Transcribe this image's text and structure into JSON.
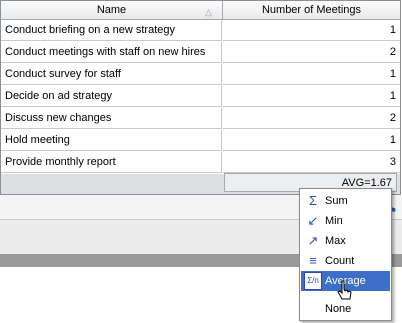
{
  "grid": {
    "columns": [
      "Name",
      "Number of Meetings"
    ],
    "rows": [
      {
        "name": "Conduct briefing on a new strategy",
        "value": "1"
      },
      {
        "name": "Conduct meetings with staff on new hires",
        "value": "2"
      },
      {
        "name": "Conduct survey for staff",
        "value": "1"
      },
      {
        "name": "Decide on ad strategy",
        "value": "1"
      },
      {
        "name": "Discuss new changes",
        "value": "2"
      },
      {
        "name": "Hold meeting",
        "value": "1"
      },
      {
        "name": "Provide monthly report",
        "value": "3"
      }
    ],
    "summary": "AVG=1.67"
  },
  "menu": {
    "items": [
      {
        "label": "Sum",
        "icon": "sigma-icon",
        "glyph": "Σ"
      },
      {
        "label": "Min",
        "icon": "min-icon",
        "glyph": "↙"
      },
      {
        "label": "Max",
        "icon": "max-icon",
        "glyph": "↗"
      },
      {
        "label": "Count",
        "icon": "count-icon",
        "glyph": "≡"
      },
      {
        "label": "Average",
        "icon": "average-icon",
        "glyph": "Σ/n"
      },
      {
        "label": "None",
        "icon": "",
        "glyph": ""
      }
    ],
    "selected": "Average"
  },
  "colors": {
    "selection": "#3d6fc8",
    "icon": "#2d4fa8"
  }
}
